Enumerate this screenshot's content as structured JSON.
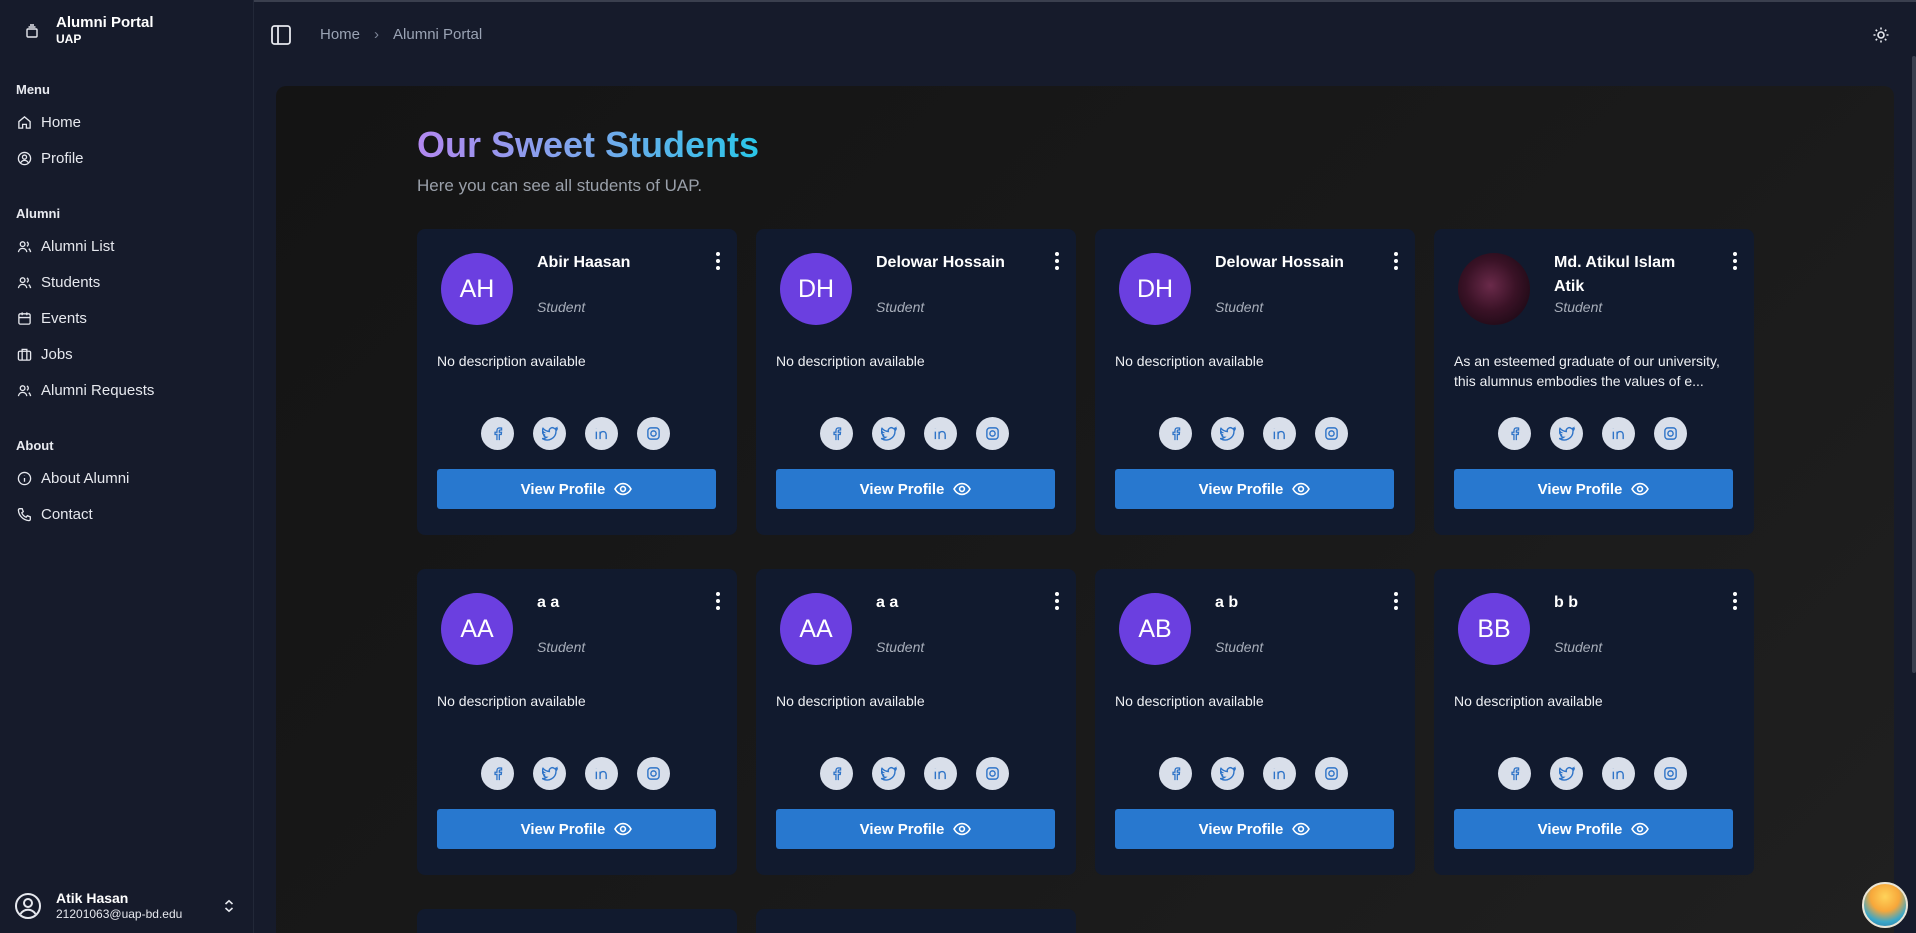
{
  "app": {
    "title": "Alumni Portal",
    "subtitle": "UAP"
  },
  "sidebar": {
    "groups": [
      {
        "label": "Menu",
        "items": [
          {
            "label": "Home",
            "icon": "home-icon"
          },
          {
            "label": "Profile",
            "icon": "user-circle-icon"
          }
        ]
      },
      {
        "label": "Alumni",
        "items": [
          {
            "label": "Alumni List",
            "icon": "users-icon"
          },
          {
            "label": "Students",
            "icon": "users-icon"
          },
          {
            "label": "Events",
            "icon": "calendar-icon"
          },
          {
            "label": "Jobs",
            "icon": "briefcase-icon"
          },
          {
            "label": "Alumni Requests",
            "icon": "users-icon"
          }
        ]
      },
      {
        "label": "About",
        "items": [
          {
            "label": "About Alumni",
            "icon": "info-icon"
          },
          {
            "label": "Contact",
            "icon": "phone-icon"
          }
        ]
      }
    ],
    "user": {
      "name": "Atik Hasan",
      "email": "21201063@uap-bd.edu"
    }
  },
  "breadcrumb": {
    "items": [
      "Home",
      "Alumni Portal"
    ],
    "separator": "›"
  },
  "page": {
    "title": "Our Sweet Students",
    "subtitle": "Here you can see all students of UAP."
  },
  "cards": [
    {
      "initials": "AH",
      "name": "Abir Haasan",
      "role": "Student",
      "description": "No description available",
      "button": "View Profile"
    },
    {
      "initials": "DH",
      "name": "Delowar Hossain",
      "role": "Student",
      "description": "No description available",
      "button": "View Profile"
    },
    {
      "initials": "DH",
      "name": "Delowar Hossain",
      "role": "Student",
      "description": "No description available",
      "button": "View Profile"
    },
    {
      "initials": "",
      "name": "Md. Atikul Islam Atik",
      "role": "Student",
      "description": "As an esteemed graduate of our university, this alumnus embodies the values of e...",
      "button": "View Profile"
    },
    {
      "initials": "AA",
      "name": "a a",
      "role": "Student",
      "description": "No description available",
      "button": "View Profile"
    },
    {
      "initials": "AA",
      "name": "a a",
      "role": "Student",
      "description": "No description available",
      "button": "View Profile"
    },
    {
      "initials": "AB",
      "name": "a b",
      "role": "Student",
      "description": "No description available",
      "button": "View Profile"
    },
    {
      "initials": "BB",
      "name": "b b",
      "role": "Student",
      "description": "No description available",
      "button": "View Profile"
    }
  ],
  "colors": {
    "accent": "#2878cf",
    "avatar": "#6b3fe0",
    "card": "#111a2e",
    "sidebar": "#161b2b"
  }
}
